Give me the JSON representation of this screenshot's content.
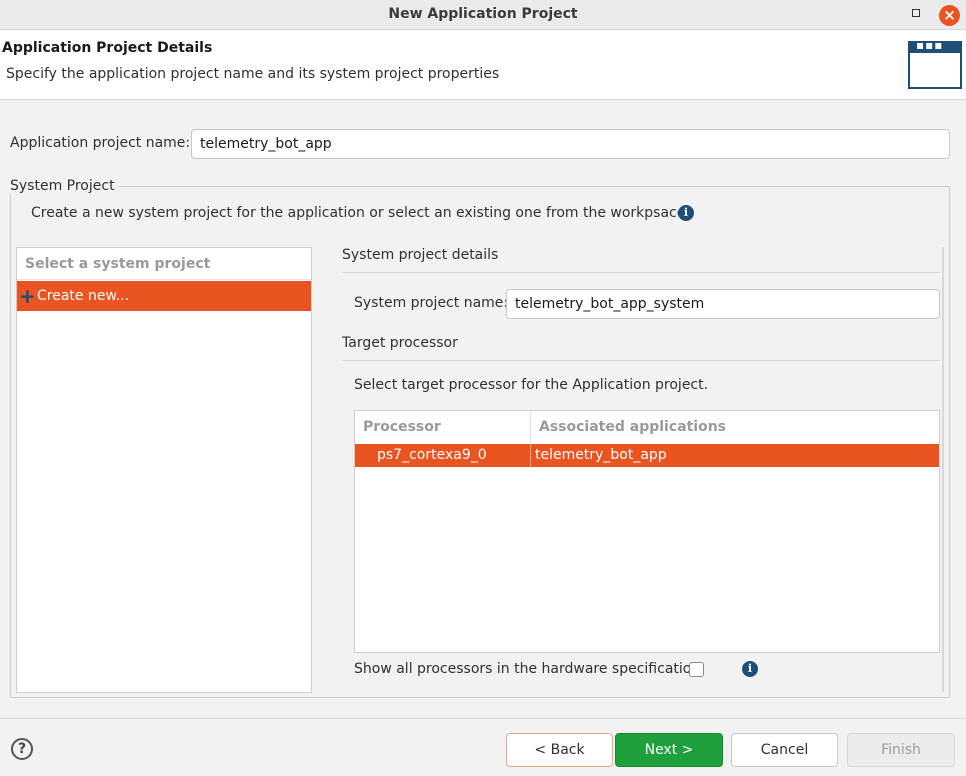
{
  "window": {
    "title": "New Application Project",
    "close_glyph": "×"
  },
  "header": {
    "title": "Application Project Details",
    "subtitle": "Specify the application project name and its system project properties"
  },
  "app_project": {
    "label": "Application project name:",
    "value": "telemetry_bot_app"
  },
  "system_project": {
    "group_label": "System Project",
    "description": "Create a new system project for the application or select an existing one from the workpsace",
    "list": {
      "header": "Select a system project",
      "items": [
        {
          "label": "Create new...",
          "selected": true,
          "icon": "plus-icon"
        }
      ]
    },
    "details": {
      "section_title": "System project details",
      "name_label": "System project name:",
      "name_value": "telemetry_bot_app_system"
    },
    "target": {
      "section_title": "Target processor",
      "description": "Select target processor for the Application project.",
      "columns": [
        "Processor",
        "Associated applications"
      ],
      "rows": [
        {
          "processor": "ps7_cortexa9_0",
          "apps": "telemetry_bot_app",
          "selected": true
        }
      ],
      "show_all_label": "Show all processors in the hardware specification",
      "show_all_checked": false
    }
  },
  "footer": {
    "help_glyph": "?",
    "back_label": "< Back",
    "next_label": "Next >",
    "cancel_label": "Cancel",
    "finish_label": "Finish"
  },
  "colors": {
    "selection": "#e95420",
    "primary_button": "#1ea13d",
    "icon_blue": "#1f4e79"
  }
}
